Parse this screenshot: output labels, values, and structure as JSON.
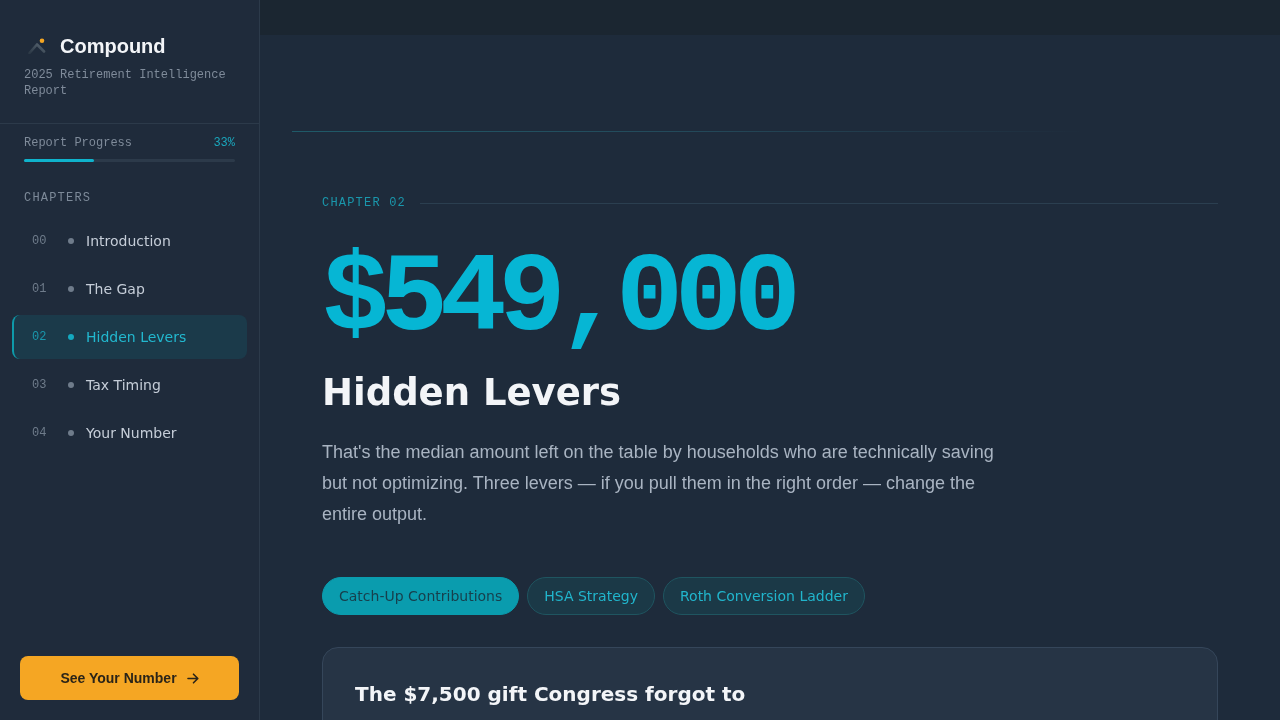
{
  "brand": {
    "name": "Compound",
    "subtitle": "2025 Retirement Intelligence Report"
  },
  "progress": {
    "label": "Report Progress",
    "reading": "33%",
    "level": 0.33
  },
  "chapters": {
    "heading": "CHAPTERS",
    "items": [
      {
        "number": "00",
        "title": "Introduction",
        "selected": false
      },
      {
        "number": "01",
        "title": "The Gap",
        "selected": false
      },
      {
        "number": "02",
        "title": "Hidden Levers",
        "selected": true
      },
      {
        "number": "03",
        "title": "Tax Timing",
        "selected": false
      },
      {
        "number": "04",
        "title": "Your Number",
        "selected": false
      }
    ]
  },
  "cta_button": {
    "label": "See Your Number"
  },
  "main": {
    "eyebrow": "CHAPTER 02",
    "figure": "$549,000",
    "title": "Hidden Levers",
    "body": "That's the median amount left on the table by households who are technically saving but not optimizing. Three levers — if you pull them in the right order — change the entire output.",
    "tabs": [
      {
        "label": "Catch-Up Contributions",
        "selected": true
      },
      {
        "label": "HSA Strategy",
        "selected": false
      },
      {
        "label": "Roth Conversion Ladder",
        "selected": false
      }
    ],
    "card": {
      "title": "The $7,500 gift Congress forgot to"
    }
  }
}
